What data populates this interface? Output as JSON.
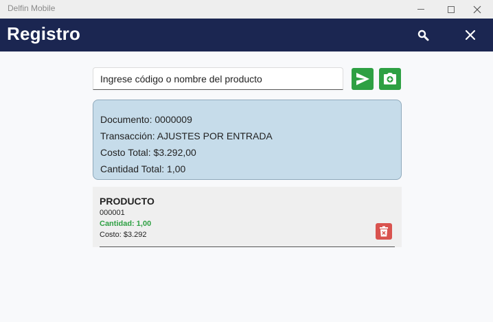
{
  "window": {
    "title": "Delfin Mobile"
  },
  "appbar": {
    "title": "Registro",
    "search_icon": "search-icon",
    "close_icon": "close-icon"
  },
  "search": {
    "placeholder": "Ingrese código o nombre del producto",
    "value": ""
  },
  "actions": {
    "send_icon": "send-icon",
    "camera_icon": "camera-add-icon",
    "accent_color": "#2ea043"
  },
  "summary": {
    "documento": "Documento: 0000009",
    "transaccion": "Transacción: AJUSTES POR ENTRADA",
    "costo_total": "Costo Total: $3.292,00",
    "cantidad_total": "Cantidad Total: 1,00"
  },
  "products": [
    {
      "name": "PRODUCTO",
      "code": "000001",
      "quantity": "Cantidad: 1,00",
      "cost": "Costo: $3.292",
      "delete_icon": "trash-icon"
    }
  ],
  "colors": {
    "header": "#1b2651",
    "summary_bg": "#c6dcea",
    "delete": "#d9534f"
  }
}
